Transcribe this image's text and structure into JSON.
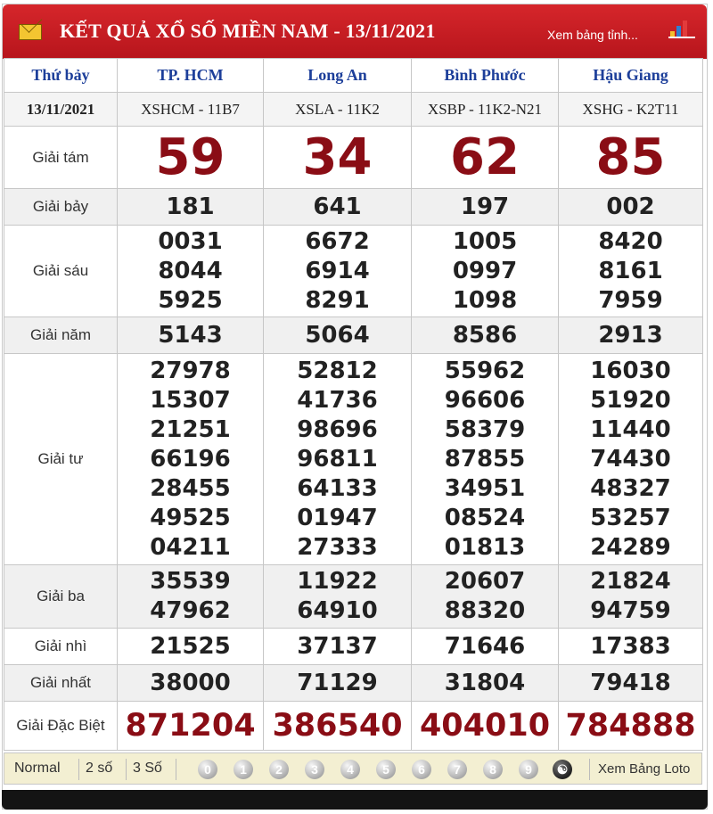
{
  "header": {
    "title": "KẾT QUẢ XỔ SỐ MIỀN NAM - 13/11/2021",
    "link": "Xem bảng tỉnh..."
  },
  "table": {
    "day": "Thứ bảy",
    "date": "13/11/2021",
    "provinces": [
      {
        "name": "TP. HCM",
        "code": "XSHCM - 11B7"
      },
      {
        "name": "Long An",
        "code": "XSLA - 11K2"
      },
      {
        "name": "Bình Phước",
        "code": "XSBP - 11K2-N21"
      },
      {
        "name": "Hậu Giang",
        "code": "XSHG - K2T11"
      }
    ],
    "prizes": [
      {
        "label": "Giải tám",
        "values": [
          "59",
          "34",
          "62",
          "85"
        ]
      },
      {
        "label": "Giải bảy",
        "values": [
          "181",
          "641",
          "197",
          "002"
        ]
      },
      {
        "label": "Giải sáu",
        "values": [
          [
            "0031",
            "8044",
            "5925"
          ],
          [
            "6672",
            "6914",
            "8291"
          ],
          [
            "1005",
            "0997",
            "1098"
          ],
          [
            "8420",
            "8161",
            "7959"
          ]
        ]
      },
      {
        "label": "Giải năm",
        "values": [
          "5143",
          "5064",
          "8586",
          "2913"
        ]
      },
      {
        "label": "Giải tư",
        "values": [
          [
            "27978",
            "15307",
            "21251",
            "66196",
            "28455",
            "49525",
            "04211"
          ],
          [
            "52812",
            "41736",
            "98696",
            "96811",
            "64133",
            "01947",
            "27333"
          ],
          [
            "55962",
            "96606",
            "58379",
            "87855",
            "34951",
            "08524",
            "01813"
          ],
          [
            "16030",
            "51920",
            "11440",
            "74430",
            "48327",
            "53257",
            "24289"
          ]
        ]
      },
      {
        "label": "Giải ba",
        "values": [
          [
            "35539",
            "47962"
          ],
          [
            "11922",
            "64910"
          ],
          [
            "20607",
            "88320"
          ],
          [
            "21824",
            "94759"
          ]
        ]
      },
      {
        "label": "Giải nhì",
        "values": [
          "21525",
          "37137",
          "71646",
          "17383"
        ]
      },
      {
        "label": "Giải nhất",
        "values": [
          "38000",
          "71129",
          "31804",
          "79418"
        ]
      },
      {
        "label": "Giải Đặc Biệt",
        "values": [
          "871204",
          "386540",
          "404010",
          "784888"
        ]
      }
    ]
  },
  "footer": {
    "options": [
      "Normal",
      "2 số",
      "3 Số"
    ],
    "digits": [
      "0",
      "1",
      "2",
      "3",
      "4",
      "5",
      "6",
      "7",
      "8",
      "9"
    ],
    "loto_link": "Xem Bảng Loto"
  },
  "colors": {
    "header_red": "#c41d23",
    "number_red": "#8a0d15",
    "province_blue": "#1d3f9a"
  }
}
